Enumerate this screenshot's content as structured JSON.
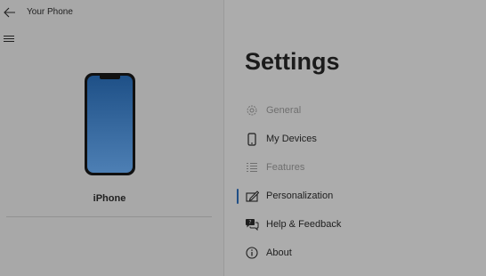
{
  "titlebar": {
    "app_title": "Your Phone"
  },
  "device": {
    "name": "iPhone"
  },
  "settings": {
    "title": "Settings",
    "menu": [
      {
        "label": "General",
        "icon": "gear-icon",
        "disabled": true,
        "selected": false
      },
      {
        "label": "My Devices",
        "icon": "phone-icon",
        "disabled": false,
        "selected": false
      },
      {
        "label": "Features",
        "icon": "list-icon",
        "disabled": true,
        "selected": false
      },
      {
        "label": "Personalization",
        "icon": "pen-tablet-icon",
        "disabled": false,
        "selected": true
      },
      {
        "label": "Help & Feedback",
        "icon": "chat-bubbles-icon",
        "disabled": false,
        "selected": false
      },
      {
        "label": "About",
        "icon": "info-icon",
        "disabled": false,
        "selected": false
      }
    ]
  },
  "colors": {
    "background": "#a9a9a9",
    "accent": "#1f4e86",
    "phone_screen_top": "#1e5087",
    "phone_screen_bottom": "#4d7fb4"
  }
}
